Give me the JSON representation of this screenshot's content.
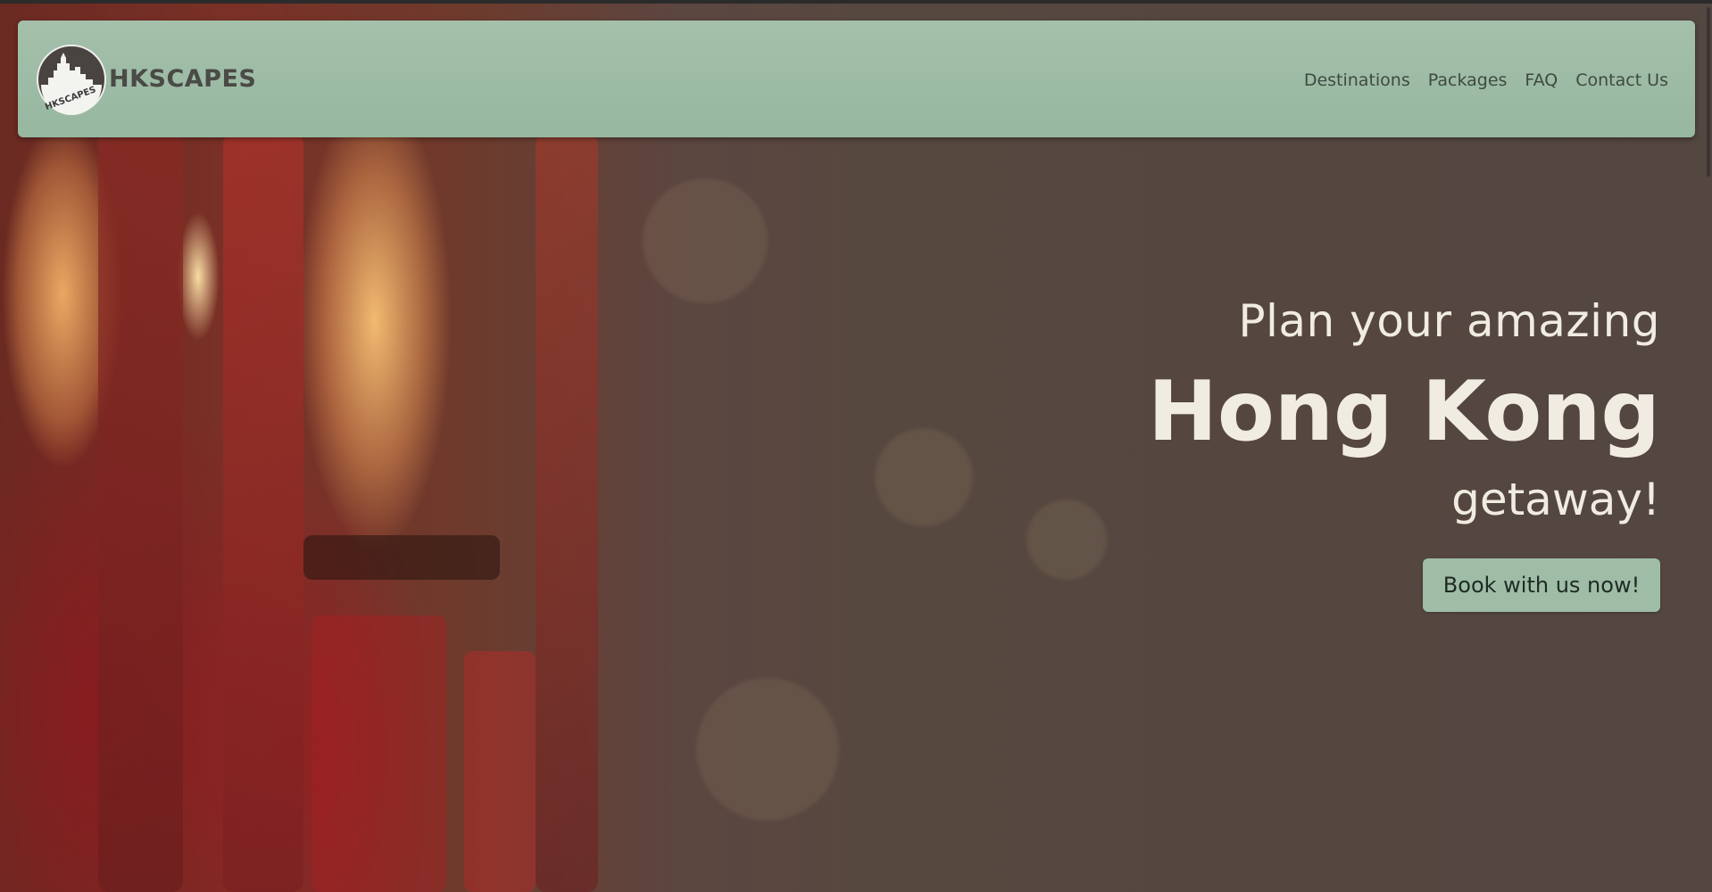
{
  "brand": {
    "name": "HKSCAPES",
    "logo_icon": "city-skyline-logo-icon",
    "logo_text": "HKSCAPES"
  },
  "nav": {
    "links": [
      {
        "label": "Destinations"
      },
      {
        "label": "Packages"
      },
      {
        "label": "FAQ"
      },
      {
        "label": "Contact Us"
      }
    ]
  },
  "hero": {
    "line1": "Plan your amazing",
    "line2": "Hong Kong",
    "line3": "getaway!",
    "cta_label": "Book with us now!"
  },
  "colors": {
    "navbar": "#a4c0aa",
    "button": "#9ebca6",
    "hero_text": "#f1ece2",
    "brand_text": "#4a4a46"
  }
}
